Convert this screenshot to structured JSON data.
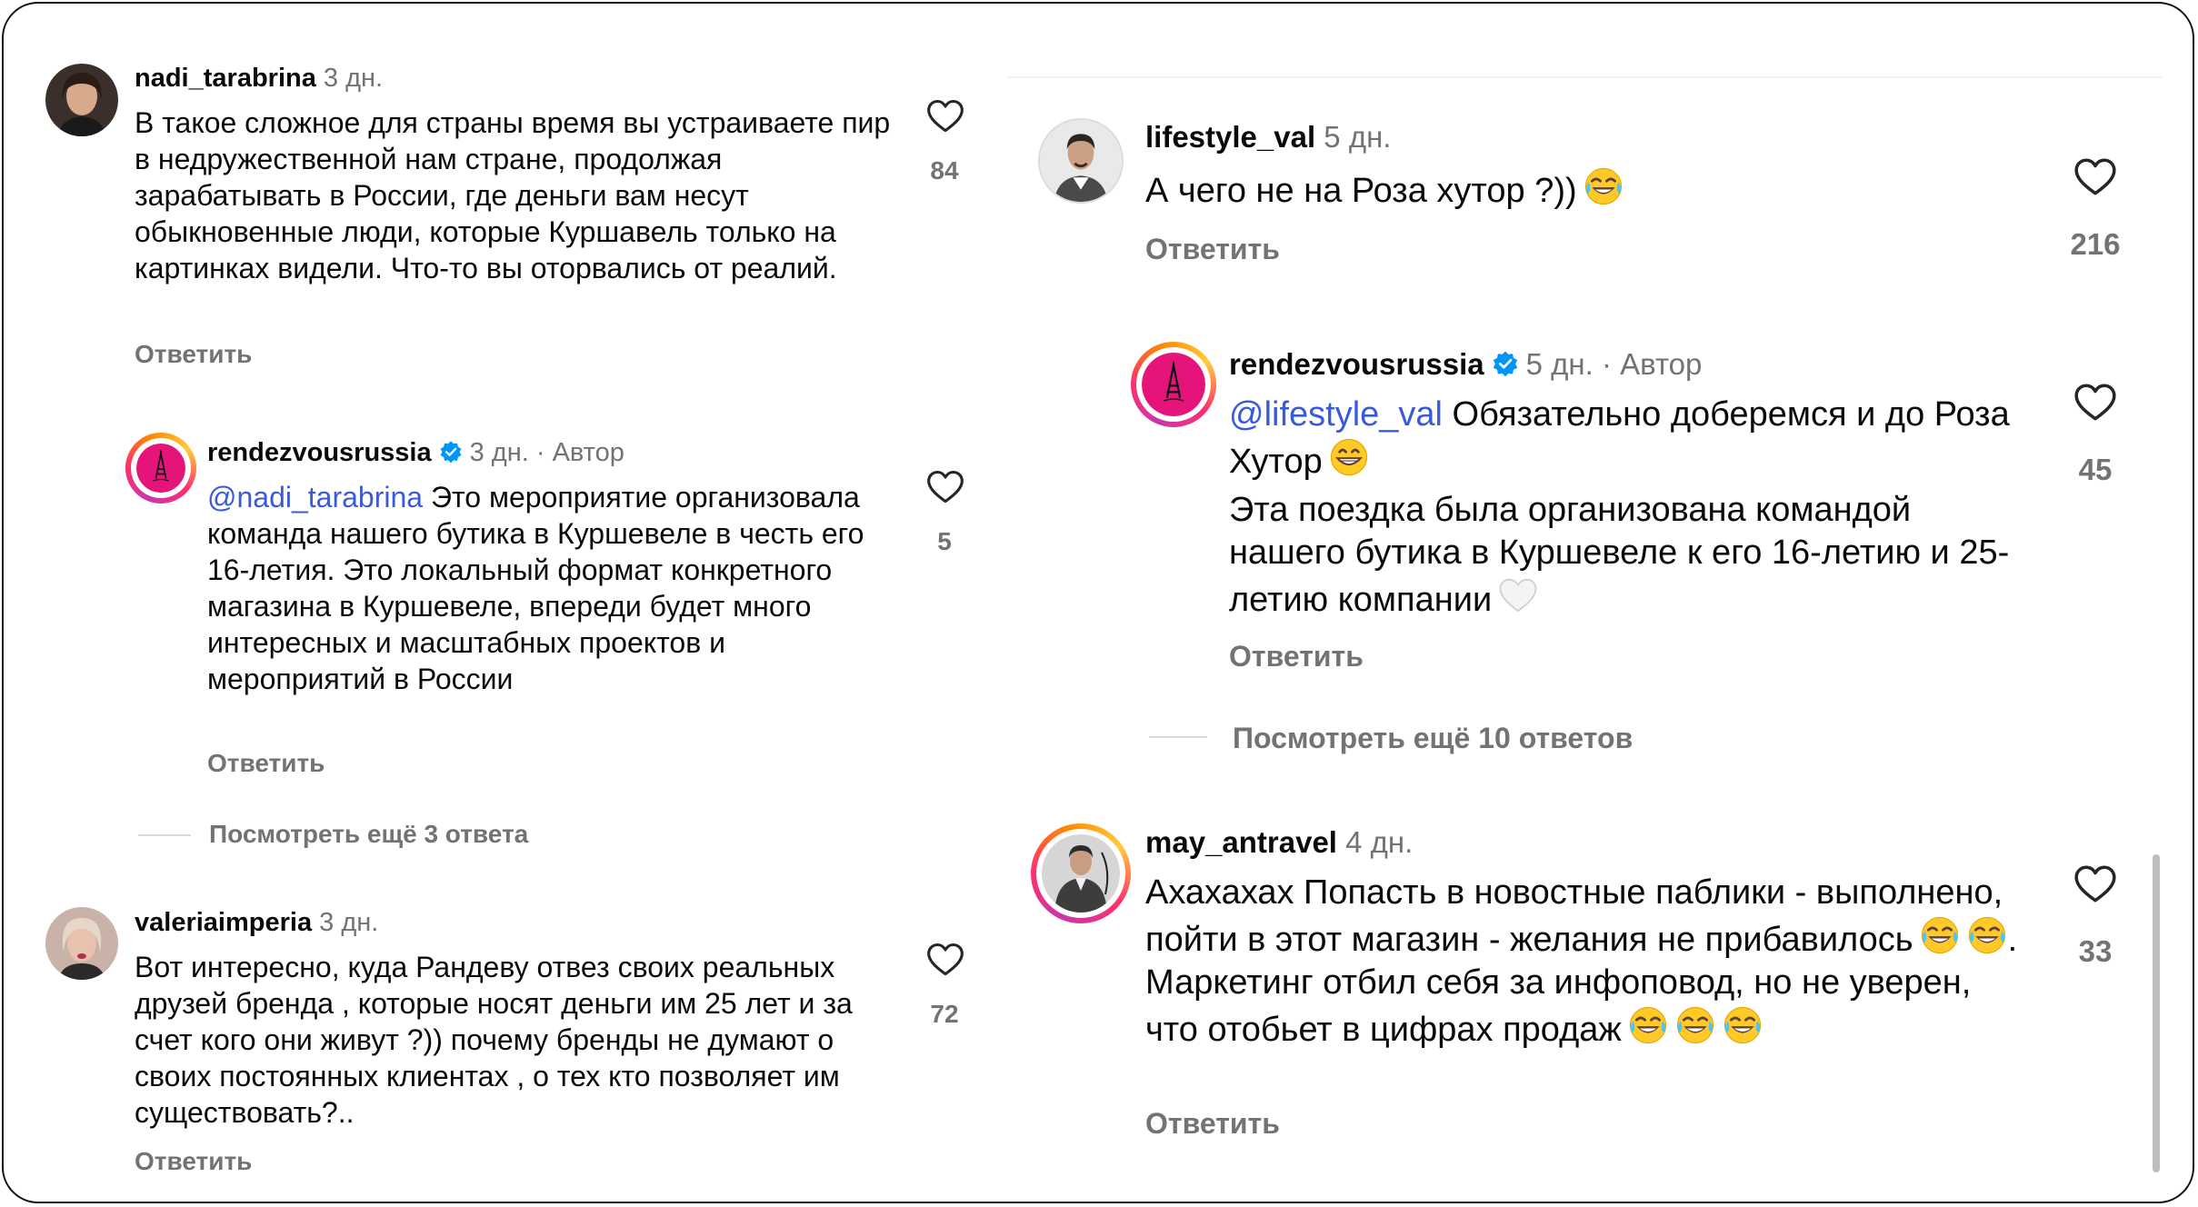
{
  "left_column": {
    "comments": [
      {
        "username": "nadi_tarabrina",
        "time": "3 дн.",
        "text": "В такое сложное для страны время вы устраиваете пир в недружественной нам стране, продолжая зарабатывать в России, где деньги вам несут обыкновенные люди, которые Куршавель только на картинках видели. Что-то вы оторвались от реалий.",
        "reply_label": "Ответить",
        "likes": "84"
      },
      {
        "username": "rendezvousrussia",
        "time": "3 дн.",
        "author_label": "· Автор",
        "mention": "@nadi_tarabrina",
        "text": " Это мероприятие организовала команда нашего бутика в Куршевеле в честь его 16-летия. Это локальный формат конкретного магазина в Куршевеле, впереди будет много интересных и масштабных проектов и мероприятий в России",
        "reply_label": "Ответить",
        "likes": "5"
      },
      {
        "username": "valeriaimperia",
        "time": "3 дн.",
        "text": "Вот интересно, куда Рандеву отвез своих реальных друзей бренда , которые носят деньги им 25 лет и за счет кого они живут ?)) почему бренды не думают о своих постоянных клиентах , о тех кто позволяет им существовать?..",
        "reply_label": "Ответить",
        "likes": "72"
      }
    ],
    "more_replies": "Посмотреть ещё 3 ответа"
  },
  "right_column": {
    "comments": [
      {
        "username": "lifestyle_val",
        "time": "5 дн.",
        "text": "А чего не на Роза хутор ?))",
        "reply_label": "Ответить",
        "likes": "216"
      },
      {
        "username": "rendezvousrussia",
        "time": "5 дн.",
        "author_label": "· Автор",
        "mention": "@lifestyle_val",
        "text_line1": " Обязательно доберемся и до Роза Хутор",
        "text_paragraph2": "Эта поездка была организована командой нашего бутика в Куршевеле к его 16-летию и 25-летию компании",
        "reply_label": "Ответить",
        "likes": "45"
      },
      {
        "username": "may_antravel",
        "time": "4 дн.",
        "text_part1": "Ахахахах Попасть в новостные паблики - выполнено, пойти в этот магазин - желания не прибавилось",
        "text_part2": ". Маркетинг отбил себя за инфоповод, но не уверен, что отобьет в цифрах продаж",
        "reply_label": "Ответить",
        "likes": "33"
      }
    ],
    "more_replies": "Посмотреть ещё 10 ответов"
  },
  "icons": {
    "like": "heart-outline-icon",
    "verified": "verified-badge-icon",
    "laugh_emoji": "face-with-tears-of-joy-emoji",
    "grin_emoji": "grinning-face-emoji",
    "white_heart_emoji": "white-heart-emoji"
  },
  "colors": {
    "mention": "#3a5bd9",
    "secondary_text": "#737373",
    "verified": "#0095f6",
    "brand_pink": "#e4147a"
  }
}
